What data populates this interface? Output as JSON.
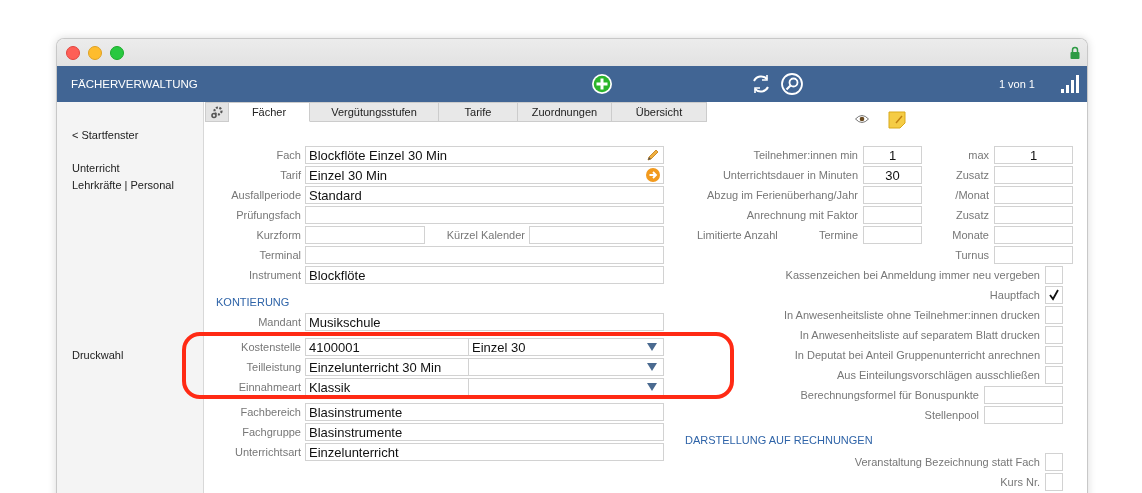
{
  "header": {
    "title": "FÄCHERVERWALTUNG",
    "record_counter": "1 von 1"
  },
  "sidebar": {
    "back_link": "< Startfenster",
    "links": [
      "Unterricht",
      "Lehrkräfte | Personal"
    ],
    "print_link": "Druckwahl"
  },
  "tabs": [
    {
      "label": "Fächer",
      "selected": true
    },
    {
      "label": "Vergütungsstufen",
      "selected": false
    },
    {
      "label": "Tarife",
      "selected": false
    },
    {
      "label": "Zuordnungen",
      "selected": false
    },
    {
      "label": "Übersicht",
      "selected": false
    }
  ],
  "main_fields": [
    {
      "kind": "edit",
      "label": "Fach",
      "value": "Blockflöte Einzel 30 Min"
    },
    {
      "kind": "goto",
      "label": "Tarif",
      "value": "Einzel 30 Min"
    },
    {
      "kind": "text",
      "label": "Ausfallperiode",
      "value": "Standard"
    },
    {
      "kind": "text",
      "label": "Prüfungsfach"
    },
    {
      "kind": "pair",
      "label": "Kurzform",
      "label_2": "Kürzel Kalender"
    },
    {
      "kind": "text",
      "label": "Terminal"
    },
    {
      "kind": "text",
      "label": "Instrument",
      "value": "Blockflöte"
    }
  ],
  "kontierung": {
    "heading": "KONTIERUNG",
    "fields": [
      {
        "kind": "text",
        "label": "Mandant",
        "value": "Musikschule"
      },
      {
        "kind": "combo",
        "label": "Kostenstelle",
        "value": "4100001",
        "value_2": "Einzel 30"
      },
      {
        "kind": "combo",
        "label": "Teilleistung",
        "value": "Einzelunterricht 30 Min"
      },
      {
        "kind": "combo",
        "label": "Einnahmeart",
        "value": "Klassik"
      },
      {
        "kind": "text",
        "label": "Fachbereich",
        "value": "Blasinstrumente"
      },
      {
        "kind": "text",
        "label": "Fachgruppe",
        "value": "Blasinstrumente"
      },
      {
        "kind": "text",
        "label": "Unterrichtsart",
        "value": "Einzelunterricht"
      }
    ]
  },
  "settings": [
    {
      "kind": "pair",
      "label": "Teilnehmer:innen min",
      "value": "1",
      "label_2": "max",
      "value_2": "1"
    },
    {
      "kind": "pair",
      "label": "Unterrichtsdauer in Minuten",
      "value": "30",
      "label_2": "Zusatz"
    },
    {
      "kind": "pair",
      "label": "Abzug im Ferienüberhang/Jahr",
      "label_2": "/Monat"
    },
    {
      "kind": "pair",
      "label": "Anrechnung mit Faktor",
      "label_2": "Zusatz"
    },
    {
      "kind": "limit",
      "label": "Limitierte Anzahl",
      "sublabel": "Termine",
      "label_2": "Monate"
    },
    {
      "kind": "right",
      "label_2": "Turnus"
    },
    {
      "kind": "checkbox",
      "label": "Kassenzeichen bei Anmeldung immer neu vergeben",
      "checked": false
    },
    {
      "kind": "checkbox",
      "label": "Hauptfach",
      "checked": true
    },
    {
      "kind": "checkbox",
      "label": "In Anwesenheitsliste ohne Teilnehmer:innen drucken",
      "checked": false
    },
    {
      "kind": "checkbox",
      "label": "In Anwesenheitsliste auf separatem Blatt drucken",
      "checked": false
    },
    {
      "kind": "checkbox",
      "label": "In Deputat bei Anteil Gruppenunterricht anrechnen",
      "checked": false
    },
    {
      "kind": "checkbox",
      "label": "Aus Einteilungsvorschlägen ausschließen",
      "checked": false
    },
    {
      "kind": "field",
      "label": "Berechnungsformel für Bonuspunkte"
    },
    {
      "kind": "field",
      "label": "Stellenpool"
    }
  ],
  "invoice": {
    "heading": "DARSTELLUNG AUF RECHNUNGEN",
    "options": [
      {
        "kind": "checkbox",
        "label": "Veranstaltung Bezeichnung statt Fach",
        "checked": false
      },
      {
        "kind": "checkbox",
        "label": "Kurs Nr.",
        "checked": false
      }
    ]
  }
}
